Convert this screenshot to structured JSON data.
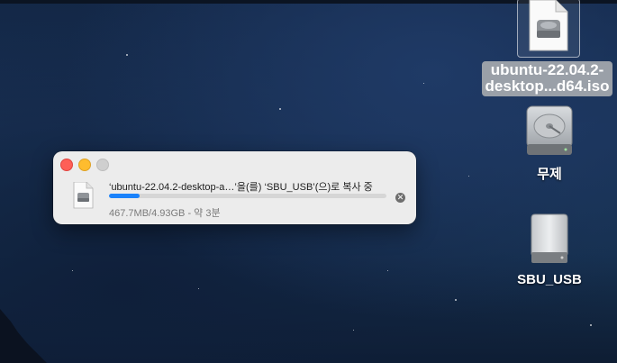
{
  "desktop": {
    "items": [
      {
        "id": "iso",
        "label_line1": "ubuntu-22.04.2-",
        "label_line2": "desktop...d64.iso",
        "icon": "disk-image-icon"
      },
      {
        "id": "untitled",
        "label": "무제",
        "icon": "internal-drive-icon"
      },
      {
        "id": "usb",
        "label": "SBU_USB",
        "icon": "external-drive-icon"
      }
    ]
  },
  "copy_dialog": {
    "title": "‘ubuntu-22.04.2-desktop-a…’을(를) ‘SBU_USB’(으)로 복사 중",
    "status": "467.7MB/4.93GB - 약 3분",
    "progress": 0.11,
    "cancel_glyph": "✕",
    "accent": "#1a82fb"
  }
}
